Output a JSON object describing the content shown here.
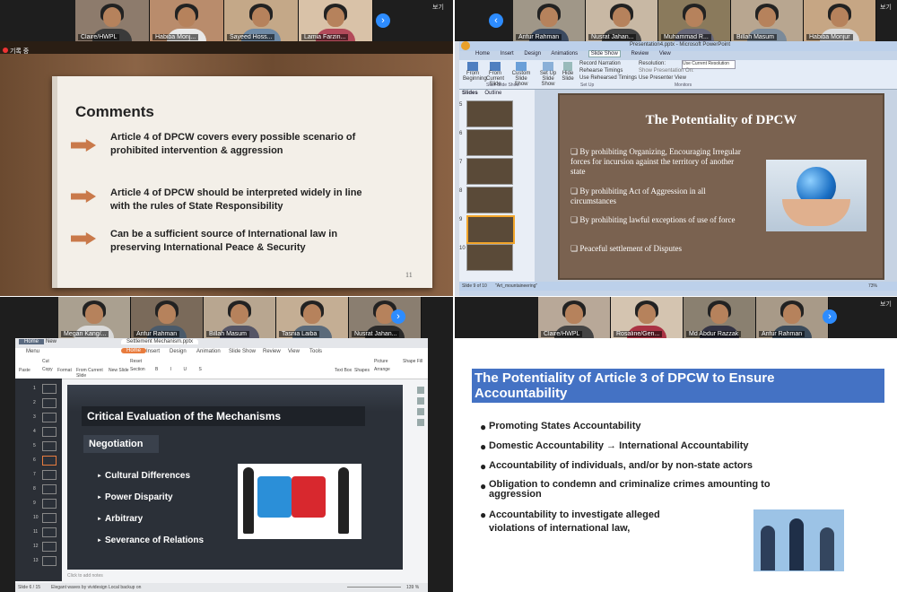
{
  "q1": {
    "participants": [
      {
        "name": "Claire/HWPL"
      },
      {
        "name": "Habiba Monj..."
      },
      {
        "name": "Sayeed Hoss..."
      },
      {
        "name": "Lamia Farzin..."
      }
    ],
    "view_label": "보기",
    "rec_label": "기록 중",
    "slide": {
      "title": "Comments",
      "items": [
        "Article 4 of DPCW covers every possible scenario of prohibited intervention & aggression",
        "Article 4 of DPCW should be interpreted widely in line with the rules of State Responsibility",
        "Can be a sufficient source of International law in preserving International Peace & Security"
      ],
      "page_number": "11"
    }
  },
  "q2": {
    "participants": [
      {
        "name": "Arifur Rahman"
      },
      {
        "name": "Nusrat Jahan..."
      },
      {
        "name": "Muhammad R..."
      },
      {
        "name": "Billah Masum"
      },
      {
        "name": "Habiba Monjur"
      }
    ],
    "view_label": "보기",
    "window_title": "Presentation4.pptx - Microsoft PowerPoint",
    "ribbon_tabs": [
      "Home",
      "Insert",
      "Design",
      "Animations",
      "Slide Show",
      "Review",
      "View"
    ],
    "active_tab": "Slide Show",
    "ribbon_buttons": [
      "From Beginning",
      "From Current Slide",
      "Custom Slide Show",
      "Set Up Slide Show",
      "Hide Slide"
    ],
    "ribbon_small": [
      "Record Narration",
      "Rehearse Timings",
      "Use Rehearsed Timings"
    ],
    "resolution_label": "Resolution:",
    "resolution_value": "Use Current Resolution",
    "show_presentation_on": "Show Presentation On:",
    "presenter_view": "Use Presenter View",
    "group_labels": [
      "Start Slide Show",
      "Set Up",
      "Monitors"
    ],
    "panel_tabs": [
      "Slides",
      "Outline"
    ],
    "slide": {
      "title": "The Potentiality of DPCW",
      "bullets": [
        "❏ By prohibiting Organizing, Encouraging Irregular forces for incursion against the territory of another state",
        "❏ By prohibiting Act of Aggression in all circumstances",
        "❏ By prohibiting lawful exceptions of use of force",
        "❏ Peaceful settlement of Disputes"
      ]
    },
    "status_left": "Slide 9 of 10",
    "status_theme": "\"Art_mountaineering\"",
    "zoom": "73%"
  },
  "q3": {
    "participants": [
      {
        "name": "Megan Kang/..."
      },
      {
        "name": "Arifur Rahman"
      },
      {
        "name": "Billah Masum"
      },
      {
        "name": "Tasnia Laiba"
      },
      {
        "name": "Nusrat Jahan..."
      }
    ],
    "app_tabs": [
      "Home",
      "New"
    ],
    "doc_tab": "Settlement Mechanism.pptx",
    "menu_label": "Menu",
    "ribbon_tabs": [
      "Home",
      "Insert",
      "Design",
      "Animation",
      "Slide Show",
      "Review",
      "View",
      "Tools"
    ],
    "active_tab": "Home",
    "tool_buttons": [
      "Paste",
      "Cut",
      "Copy",
      "Format",
      "From Current Slide",
      "New Slide",
      "Reset",
      "Section",
      "Text Box",
      "Shapes",
      "Picture",
      "Arrange",
      "Shape Fill"
    ],
    "slide": {
      "title": "Critical Evaluation of the Mechanisms",
      "subtitle": "Negotiation",
      "bullets": [
        "Cultural Differences",
        "Power Disparity",
        "Arbitrary",
        "Severance of Relations"
      ]
    },
    "notes_placeholder": "Click to add notes",
    "status_left": "Slide 6 / 15",
    "status_theme": "Elegant waves by vividesign",
    "status_backup": "Local backup on",
    "zoom": "139 %"
  },
  "q4": {
    "participants": [
      {
        "name": "Claire/HWPL"
      },
      {
        "name": "Rosaline/Gen..."
      },
      {
        "name": "Md Abdur Razzak"
      },
      {
        "name": "Arifur Rahman"
      }
    ],
    "view_label": "보기",
    "slide": {
      "title": "The Potentiality of Article 3 of DPCW to Ensure Accountability",
      "bullets": [
        "Promoting States Accountability",
        "Domestic Accountability → International Accountability",
        "Accountability of individuals, and/or by non-state actors",
        "Obligation to condemn and criminalize crimes amounting to aggression",
        "Accountability to investigate alleged violations of international law,"
      ]
    }
  },
  "colors": {
    "zoom_blue": "#2d8cff",
    "wood": "#6b4a30",
    "ppt_brown": "#7a6250",
    "slide_blue": "#4472c4",
    "wps_dark": "#2b3038"
  }
}
